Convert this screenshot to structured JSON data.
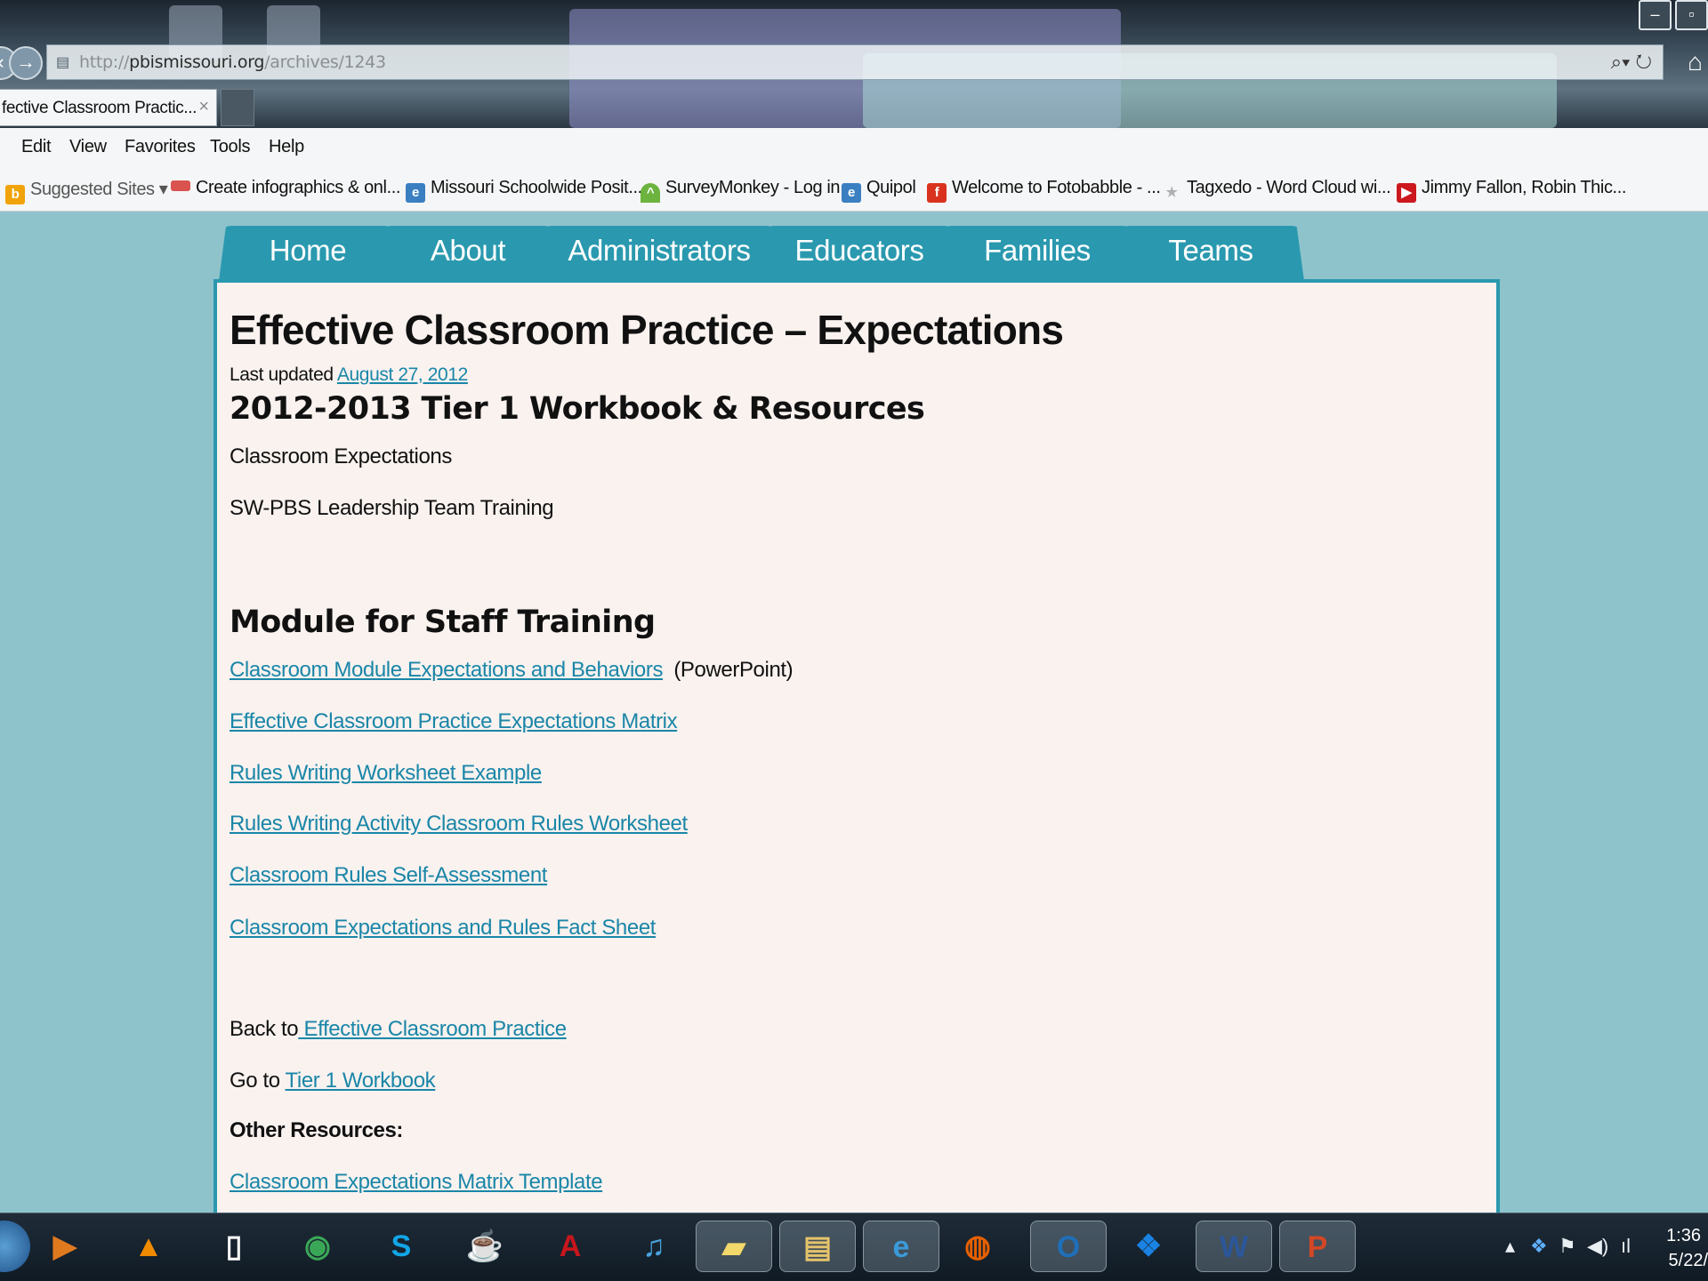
{
  "browser": {
    "url_prefix": "http://",
    "url_domain": "pbismissouri.org",
    "url_path": "/archives/1243",
    "search_icon": "⌕▾",
    "refresh_icon": "↻",
    "tab_title": "fective Classroom Practic...",
    "tab_close": "×",
    "menu": [
      "Edit",
      "View",
      "Favorites",
      "Tools",
      "Help"
    ],
    "favorites": [
      {
        "label": "Suggested Sites ▾",
        "icon": "bing-icon",
        "icon_color": "#f0a30a"
      },
      {
        "label": "Create infographics & onl...",
        "icon": "infographic-icon",
        "icon_color": "#d9534f"
      },
      {
        "label": "Missouri Schoolwide Posit...",
        "icon": "ie-page-icon",
        "icon_color": "#3a7fc1"
      },
      {
        "label": "SurveyMonkey - Log in",
        "icon": "surveymonkey-icon",
        "icon_color": "#6cb33f"
      },
      {
        "label": "Quipol",
        "icon": "ie-page-icon",
        "icon_color": "#3a7fc1"
      },
      {
        "label": "Welcome to Fotobabble - ...",
        "icon": "facebook-icon",
        "icon_color": "#d9331f"
      },
      {
        "label": "Tagxedo - Word Cloud wi...",
        "icon": "star-icon",
        "icon_color": "#b0b0b0"
      },
      {
        "label": "Jimmy Fallon, Robin Thic...",
        "icon": "youtube-icon",
        "icon_color": "#cc181e"
      }
    ]
  },
  "site": {
    "nav": [
      "Home",
      "About",
      "Administrators",
      "Educators",
      "Families",
      "Teams"
    ],
    "page_title": "Effective Classroom Practice – Expectations",
    "last_updated_label": "Last updated",
    "last_updated_date": "August 27, 2012",
    "section1_heading": "2012-2013 Tier 1 Workbook & Resources",
    "section1_items": [
      "Classroom Expectations",
      "SW-PBS Leadership Team Training"
    ],
    "section2_heading": "Module for Staff Training",
    "module_links": [
      {
        "text": "Classroom Module Expectations and Behaviors",
        "suffix": " (PowerPoint)"
      },
      {
        "text": "Effective Classroom Practice Expectations Matrix",
        "suffix": ""
      },
      {
        "text": "Rules Writing Worksheet Example",
        "suffix": ""
      },
      {
        "text": "Rules Writing Activity Classroom Rules Worksheet",
        "suffix": ""
      },
      {
        "text": "Classroom Rules Self-Assessment",
        "suffix": ""
      },
      {
        "text": "Classroom Expectations and Rules Fact Sheet",
        "suffix": ""
      }
    ],
    "back_prefix": "Back to",
    "back_link": " Effective Classroom  Practice",
    "goto_prefix": "Go to",
    "goto_link": "Tier 1 Workbook",
    "other_resources_label": "Other Resources:",
    "other_link": "Classroom Expectations Matrix Template"
  },
  "taskbar": {
    "apps": [
      {
        "name": "media-player-icon",
        "glyph": "▶",
        "color": "#e07a1f"
      },
      {
        "name": "vlc-icon",
        "glyph": "▲",
        "color": "#f08a00"
      },
      {
        "name": "document-icon",
        "glyph": "▯",
        "color": "#ffffff"
      },
      {
        "name": "chrome-icon",
        "glyph": "◉",
        "color": "#3aa757"
      },
      {
        "name": "skype-icon",
        "glyph": "S",
        "color": "#12a5e6"
      },
      {
        "name": "java-icon",
        "glyph": "☕",
        "color": "#e0e0e0"
      },
      {
        "name": "acrobat-icon",
        "glyph": "A",
        "color": "#c8161d"
      },
      {
        "name": "itunes-icon",
        "glyph": "♫",
        "color": "#4aa3df"
      },
      {
        "name": "sticky-notes-icon",
        "glyph": "▰",
        "color": "#f3d86b"
      },
      {
        "name": "file-explorer-icon",
        "glyph": "▤",
        "color": "#e5c36b"
      },
      {
        "name": "internet-explorer-icon",
        "glyph": "e",
        "color": "#3a9ad9"
      },
      {
        "name": "firefox-icon",
        "glyph": "◍",
        "color": "#e66000"
      },
      {
        "name": "outlook-icon",
        "glyph": "O",
        "color": "#1f6fb8"
      },
      {
        "name": "dropbox-icon",
        "glyph": "❖",
        "color": "#1a82e2"
      },
      {
        "name": "word-icon",
        "glyph": "W",
        "color": "#2b579a"
      },
      {
        "name": "powerpoint-icon",
        "glyph": "P",
        "color": "#d24726"
      }
    ],
    "clock_time": "1:36",
    "clock_date": "5/22/"
  }
}
